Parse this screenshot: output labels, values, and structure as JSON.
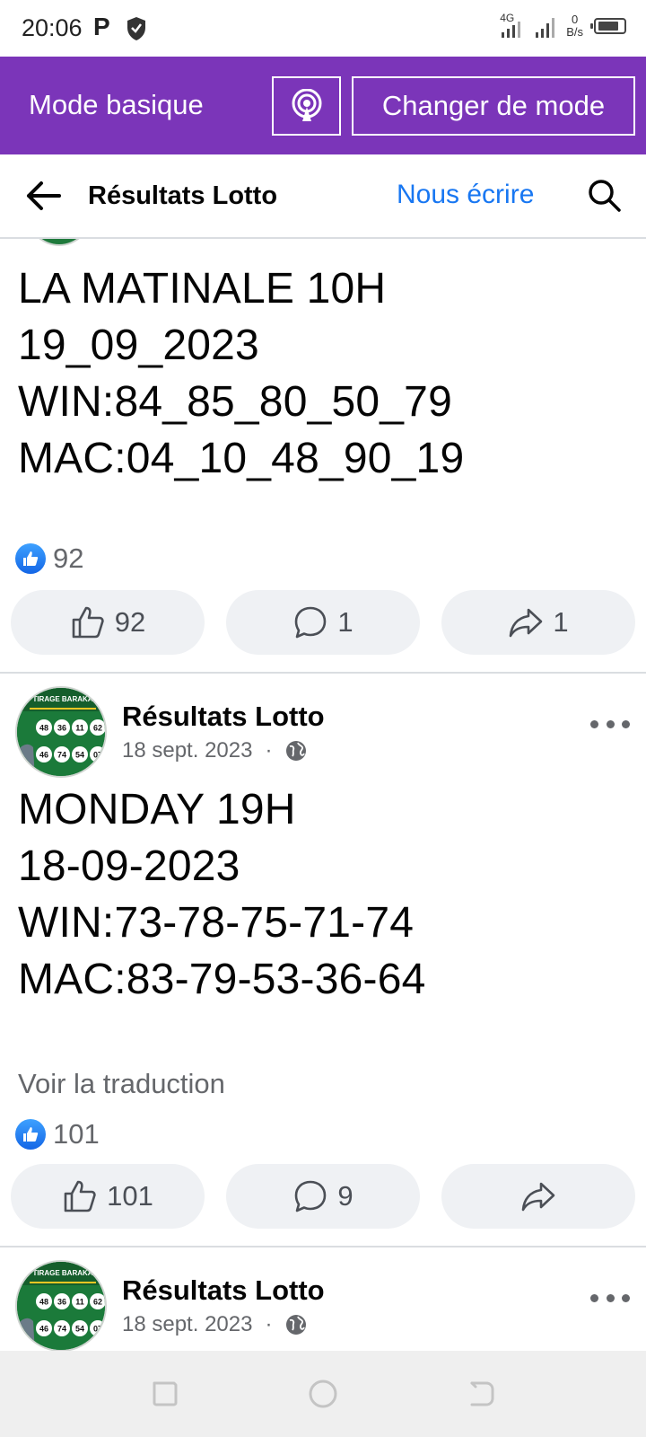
{
  "status_bar": {
    "time": "20:06",
    "network_label": "4G",
    "data_speed_value": "0",
    "data_speed_unit": "B/s"
  },
  "mode_bar": {
    "title": "Mode basique",
    "change_mode_label": "Changer de mode",
    "background_color": "#7b35b9"
  },
  "header": {
    "title": "Résultats Lotto",
    "contact_link": "Nous écrire",
    "link_color": "#1877f2"
  },
  "posts": [
    {
      "text": "LA MATINALE  10H\n19_09_2023\nWIN:84_85_80_50_79\nMAC:04_10_48_90_19",
      "reaction_count": "92",
      "like_count": "92",
      "comment_count": "1",
      "share_count": "1"
    },
    {
      "author": "Résultats Lotto",
      "date": "18 sept. 2023",
      "separator": "·",
      "text": "MONDAY 19H\n18-09-2023\nWIN:73-78-75-71-74\nMAC:83-79-53-36-64",
      "see_translation": "Voir la traduction",
      "reaction_count": "101",
      "like_count": "101",
      "comment_count": "9",
      "share_count": ""
    },
    {
      "author": "Résultats Lotto",
      "date": "18 sept. 2023",
      "separator": "·"
    }
  ],
  "avatar_image": {
    "banner": "TIRAGE BARAKA",
    "top_balls": [
      "48",
      "36",
      "11",
      "62"
    ],
    "bottom_balls": [
      "46",
      "74",
      "54",
      "07"
    ]
  },
  "icons": {
    "shield": "shield-icon",
    "broadcast": "broadcast-icon",
    "back": "arrow-left-icon",
    "search": "search-icon",
    "like": "thumbs-up-icon",
    "comment": "comment-icon",
    "share": "share-icon",
    "globe": "globe-icon",
    "more": "more-dots-icon"
  }
}
